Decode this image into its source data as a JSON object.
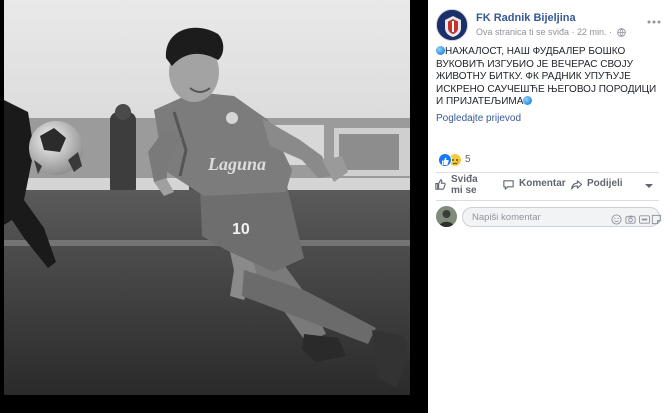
{
  "post": {
    "page_name": "FK Radnik Bijeljina",
    "meta_text": "Ova stranica ti se sviđa · 22 min. ·",
    "text": "НАЖАЛОСТ, НАШ ФУДБАЛЕР БОШКО ВУКОВИЋ ИЗГУБИО ЈЕ ВЕЧЕРАС СВОЈУ ЖИВОТНУ БИТКУ. ФК РАДНИК УПУЋУЈЕ ИСКРЕНО САУЧЕШЋЕ ЊЕГОВОЈ ПОРОДИЦИ И ПРИЈАТЕЉИМА",
    "see_translation": "Pogledajte prijevod"
  },
  "reactions": {
    "icons": [
      "like-icon",
      "sad-icon"
    ],
    "count": "5"
  },
  "actions": {
    "like_label": "Sviđa mi se",
    "comment_label": "Komentar",
    "share_label": "Podijeli"
  },
  "comment": {
    "placeholder": "Napiši komentar",
    "icons": [
      "emoji-icon",
      "camera-icon",
      "gif-icon",
      "sticker-icon"
    ]
  },
  "photo": {
    "jersey_number": "10",
    "sponsor_text": "Laguna",
    "style": "black-and-white"
  },
  "colors": {
    "link": "#385898",
    "like_blue": "#1877f2",
    "muted": "#90949c",
    "backdrop": "#000000"
  }
}
